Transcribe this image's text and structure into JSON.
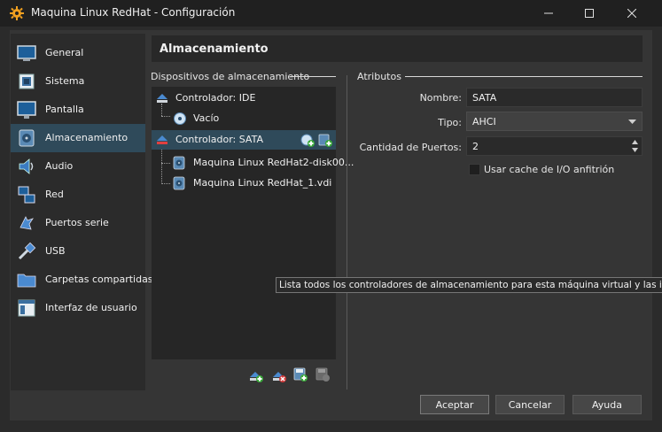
{
  "window": {
    "title": "Maquina Linux RedHat - Configuración"
  },
  "sidebar": {
    "items": [
      {
        "label": "General",
        "icon": "general-icon"
      },
      {
        "label": "Sistema",
        "icon": "system-icon"
      },
      {
        "label": "Pantalla",
        "icon": "display-icon"
      },
      {
        "label": "Almacenamiento",
        "icon": "storage-icon",
        "selected": true
      },
      {
        "label": "Audio",
        "icon": "audio-icon"
      },
      {
        "label": "Red",
        "icon": "network-icon"
      },
      {
        "label": "Puertos serie",
        "icon": "serial-port-icon"
      },
      {
        "label": "USB",
        "icon": "usb-icon"
      },
      {
        "label": "Carpetas compartidas",
        "icon": "shared-folder-icon"
      },
      {
        "label": "Interfaz de usuario",
        "icon": "user-interface-icon"
      }
    ]
  },
  "page": {
    "title": "Almacenamiento"
  },
  "devices": {
    "section_label": "Dispositivos de almacenamiento",
    "tree": [
      {
        "label": "Controlador: IDE",
        "type": "controller"
      },
      {
        "label": "Vacío",
        "type": "optical"
      },
      {
        "label": "Controlador: SATA",
        "type": "controller",
        "selected": true
      },
      {
        "label": "Maquina Linux RedHat2-disk00...",
        "type": "disk"
      },
      {
        "label": "Maquina Linux RedHat_1.vdi",
        "type": "disk"
      }
    ]
  },
  "attributes": {
    "section_label": "Atributos",
    "name_label": "Nombre:",
    "name_value": "SATA",
    "type_label": "Tipo:",
    "type_value": "AHCI",
    "ports_label": "Cantidad de Puertos:",
    "ports_value": "2",
    "cache_label": "Usar cache de I/O anfitrión",
    "cache_checked": false
  },
  "tooltip": {
    "text": "Lista todos los controladores de almacenamiento para esta máquina virtual y las imágenes"
  },
  "buttons": {
    "accept": "Aceptar",
    "cancel": "Cancelar",
    "help": "Ayuda"
  },
  "colors": {
    "selection": "#2f4a5a",
    "dialog_bg": "#353535",
    "titlebar_bg": "#202020"
  }
}
